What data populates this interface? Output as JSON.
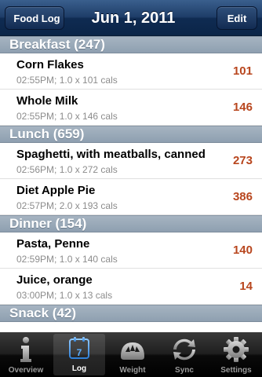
{
  "navbar": {
    "back_label": "Food Log",
    "title": "Jun 1, 2011",
    "edit_label": "Edit"
  },
  "sections": [
    {
      "header": "Breakfast (247)",
      "items": [
        {
          "name": "Corn Flakes",
          "detail": "02:55PM; 1.0 x 101 cals",
          "cals": "101"
        },
        {
          "name": "Whole Milk",
          "detail": "02:55PM; 1.0 x 146 cals",
          "cals": "146"
        }
      ]
    },
    {
      "header": "Lunch (659)",
      "items": [
        {
          "name": "Spaghetti, with meatballs, canned",
          "detail": "02:56PM; 1.0 x 272 cals",
          "cals": "273"
        },
        {
          "name": "Diet Apple Pie",
          "detail": "02:57PM; 2.0 x 193 cals",
          "cals": "386"
        }
      ]
    },
    {
      "header": "Dinner (154)",
      "items": [
        {
          "name": "Pasta, Penne",
          "detail": "02:59PM; 1.0 x 140 cals",
          "cals": "140"
        },
        {
          "name": "Juice, orange",
          "detail": "03:00PM; 1.0 x 13 cals",
          "cals": "14"
        }
      ]
    },
    {
      "header": "Snack (42)",
      "items": []
    }
  ],
  "tabbar": {
    "tabs": [
      {
        "label": "Overview",
        "icon": "info-icon"
      },
      {
        "label": "Log",
        "icon": "calendar-icon",
        "calendar_day": "7"
      },
      {
        "label": "Weight",
        "icon": "scale-icon"
      },
      {
        "label": "Sync",
        "icon": "sync-icon"
      },
      {
        "label": "Settings",
        "icon": "gear-icon"
      }
    ],
    "selected": "Log"
  },
  "colors": {
    "calorie_accent": "#b8461e",
    "navbar": "#1e3d68",
    "section_header": "#98a8b8"
  }
}
